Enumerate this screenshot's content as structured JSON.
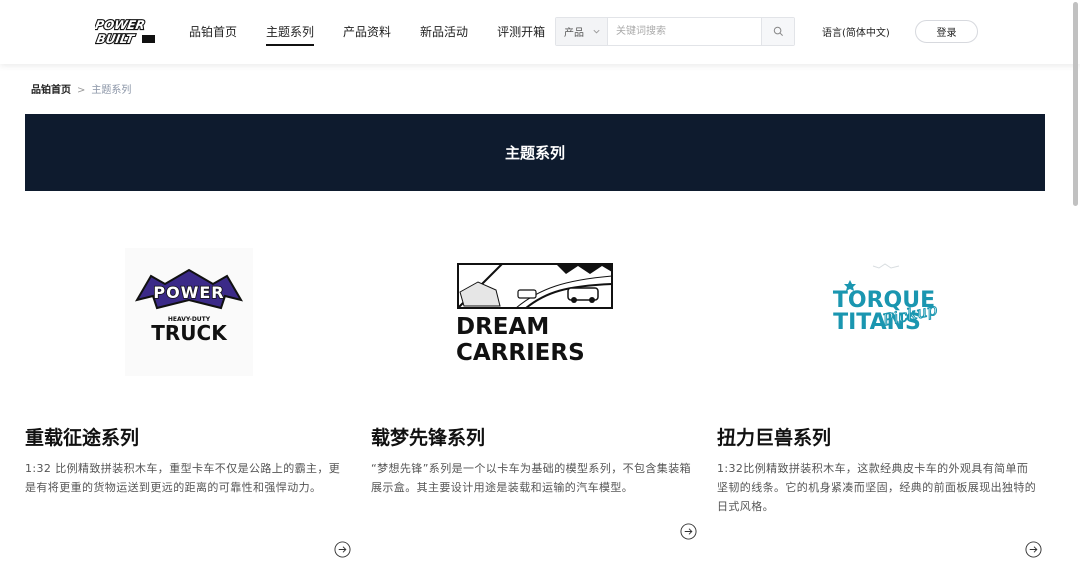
{
  "header": {
    "logo_text": "POWER BUILT",
    "nav": [
      {
        "label": "品铂首页"
      },
      {
        "label": "主题系列"
      },
      {
        "label": "产品资料"
      },
      {
        "label": "新品活动"
      },
      {
        "label": "评测开箱"
      }
    ],
    "search": {
      "category": "产品",
      "placeholder": "关键词搜索"
    },
    "language": "语言(简体中文)",
    "login": "登录"
  },
  "breadcrumb": {
    "home": "品铂首页",
    "separator": ">",
    "current": "主题系列"
  },
  "banner": {
    "title": "主题系列"
  },
  "cards": [
    {
      "title": "重载征途系列",
      "desc": "1:32 比例精致拼装积木车，重型卡车不仅是公路上的霸主，更是有将更重的货物运送到更远的距离的可靠性和强悍动力。",
      "logo_line1": "POWER",
      "logo_line2": "HEAVY-DUTY",
      "logo_line3": "TRUCK"
    },
    {
      "title": "载梦先锋系列",
      "desc": "“梦想先锋”系列是一个以卡车为基础的模型系列，不包含集装箱展示盒。其主要设计用途是装载和运输的汽车模型。",
      "logo_line1": "DREAM",
      "logo_line2": "CARRIERS"
    },
    {
      "title": "扭力巨兽系列",
      "desc": "1:32比例精致拼装积木车，这款经典皮卡车的外观具有简单而坚韧的线条。它的机身紧凑而坚固，经典的前面板展现出独特的日式风格。",
      "logo_line1": "TORQUE",
      "logo_line2": "TITANS",
      "logo_script": "Pickup"
    }
  ]
}
